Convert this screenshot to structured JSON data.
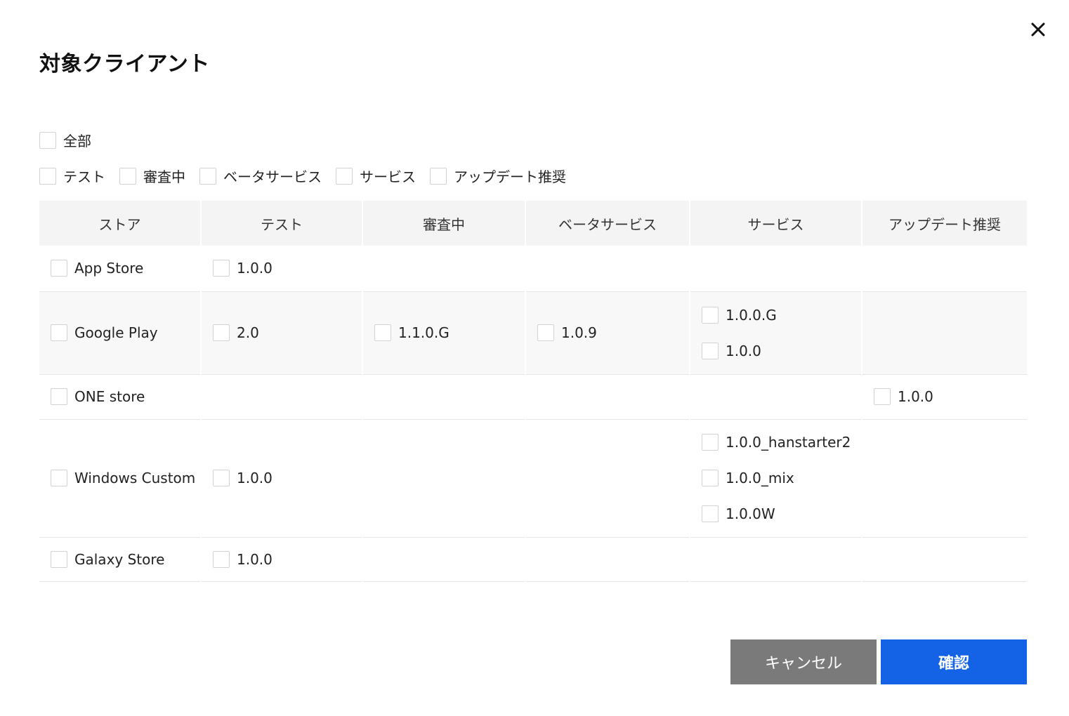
{
  "dialog": {
    "title": "対象クライアント",
    "close_icon": "close-icon"
  },
  "filters": {
    "select_all_label": "全部",
    "status_options": [
      "テスト",
      "審査中",
      "ベータサービス",
      "サービス",
      "アップデート推奨"
    ]
  },
  "table": {
    "headers": [
      "ストア",
      "テスト",
      "審査中",
      "ベータサービス",
      "サービス",
      "アップデート推奨"
    ],
    "rows": [
      {
        "store": "App Store",
        "test": [
          "1.0.0"
        ],
        "review": [],
        "beta": [],
        "service": [],
        "update": []
      },
      {
        "store": "Google Play",
        "test": [
          "2.0"
        ],
        "review": [
          "1.1.0.G"
        ],
        "beta": [
          "1.0.9"
        ],
        "service": [
          "1.0.0.G",
          "1.0.0"
        ],
        "update": []
      },
      {
        "store": "ONE store",
        "test": [],
        "review": [],
        "beta": [],
        "service": [],
        "update": [
          "1.0.0"
        ]
      },
      {
        "store": "Windows Custom",
        "test": [
          "1.0.0"
        ],
        "review": [],
        "beta": [],
        "service": [
          "1.0.0_hanstarter2",
          "1.0.0_mix",
          "1.0.0W"
        ],
        "update": []
      },
      {
        "store": "Galaxy Store",
        "test": [
          "1.0.0"
        ],
        "review": [],
        "beta": [],
        "service": [],
        "update": []
      }
    ]
  },
  "buttons": {
    "cancel_label": "キャンセル",
    "confirm_label": "確認"
  },
  "colors": {
    "primary": "#1463e6",
    "cancel": "#7a7a7a",
    "header_bg": "#f4f4f4",
    "alt_row_bg": "#f8f8f8",
    "checkbox_border": "#d2d2d2"
  }
}
